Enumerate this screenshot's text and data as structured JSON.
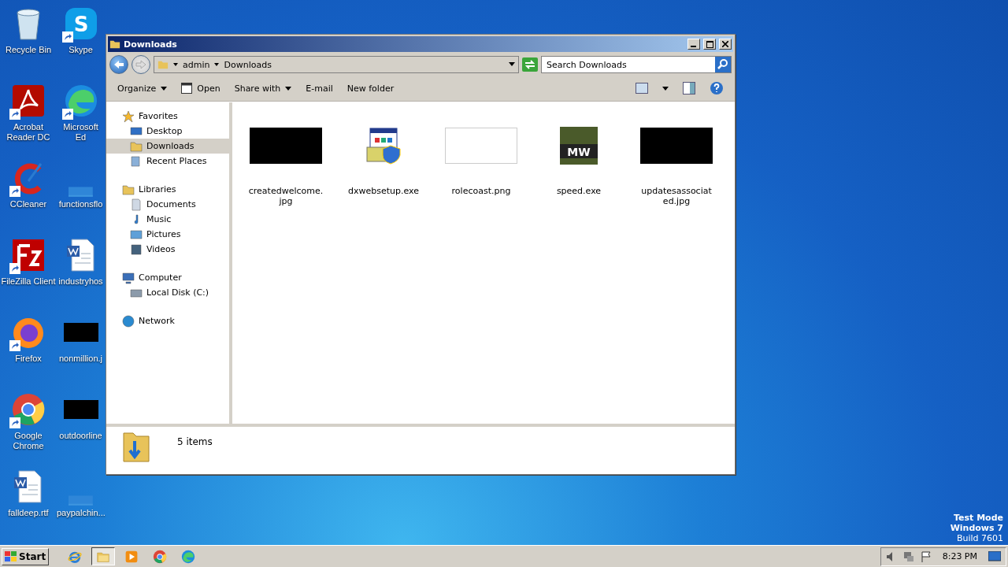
{
  "desktop_icons": [
    {
      "label": "Recycle Bin",
      "kind": "recycle",
      "shortcut": false
    },
    {
      "label": "Acrobat Reader DC",
      "kind": "acrobat",
      "shortcut": true
    },
    {
      "label": "CCleaner",
      "kind": "ccleaner",
      "shortcut": true
    },
    {
      "label": "FileZilla Client",
      "kind": "filezilla",
      "shortcut": true
    },
    {
      "label": "Firefox",
      "kind": "firefox",
      "shortcut": true
    },
    {
      "label": "Google Chrome",
      "kind": "chrome",
      "shortcut": true
    },
    {
      "label": "falldeep.rtf",
      "kind": "word",
      "shortcut": false
    },
    {
      "label": "Skype",
      "kind": "skype",
      "shortcut": true,
      "glyph": "S"
    },
    {
      "label": "Microsoft Ed",
      "kind": "edge",
      "shortcut": true
    },
    {
      "label": "functionsflo",
      "kind": "blank",
      "shortcut": false
    },
    {
      "label": "industryhos",
      "kind": "word",
      "shortcut": false
    },
    {
      "label": "nonmillion.j",
      "kind": "image",
      "shortcut": false
    },
    {
      "label": "outdoorline",
      "kind": "image",
      "shortcut": false
    },
    {
      "label": "paypalchin...",
      "kind": "blank",
      "shortcut": false
    }
  ],
  "window": {
    "title": "Downloads",
    "breadcrumb": [
      "admin",
      "Downloads"
    ],
    "search": {
      "placeholder": "Search Downloads"
    },
    "toolbar": [
      {
        "label": "Organize",
        "dropdown": true,
        "kind": "text"
      },
      {
        "label": "Open",
        "dropdown": false,
        "kind": "open"
      },
      {
        "label": "Share with",
        "dropdown": true,
        "kind": "text"
      },
      {
        "label": "E-mail",
        "dropdown": false,
        "kind": "text"
      },
      {
        "label": "New folder",
        "dropdown": false,
        "kind": "text"
      }
    ],
    "nav": [
      {
        "label": "Favorites",
        "kind": "star",
        "selected": false,
        "children": [
          {
            "label": "Desktop",
            "kind": "desktop",
            "selected": false
          },
          {
            "label": "Downloads",
            "kind": "downloads",
            "selected": true
          },
          {
            "label": "Recent Places",
            "kind": "recent",
            "selected": false
          }
        ]
      },
      {
        "label": "Libraries",
        "kind": "library",
        "selected": false,
        "children": [
          {
            "label": "Documents",
            "kind": "documents",
            "selected": false
          },
          {
            "label": "Music",
            "kind": "music",
            "selected": false
          },
          {
            "label": "Pictures",
            "kind": "pictures",
            "selected": false
          },
          {
            "label": "Videos",
            "kind": "videos",
            "selected": false
          }
        ]
      },
      {
        "label": "Computer",
        "kind": "computer",
        "selected": false,
        "children": [
          {
            "label": "Local Disk (C:)",
            "kind": "disk",
            "selected": false
          }
        ]
      },
      {
        "label": "Network",
        "kind": "network",
        "selected": false
      }
    ],
    "files": [
      {
        "name": "createdwelcome.jpg",
        "kind": "dark-image"
      },
      {
        "name": "dxwebsetup.exe",
        "kind": "installer"
      },
      {
        "name": "rolecoast.png",
        "kind": "light-image"
      },
      {
        "name": "speed.exe",
        "kind": "game",
        "glyph": "MW"
      },
      {
        "name": "updatesassociated.jpg",
        "kind": "dark-image"
      }
    ],
    "status": "5 items"
  },
  "os_notice": [
    "Test Mode",
    "Windows 7",
    "Build 7601"
  ],
  "taskbar": {
    "start": "Start",
    "apps": [
      {
        "kind": "ie",
        "selected": false
      },
      {
        "kind": "explorer",
        "selected": true
      },
      {
        "kind": "media",
        "selected": false
      },
      {
        "kind": "chrome",
        "selected": false
      },
      {
        "kind": "edge",
        "selected": false
      }
    ],
    "time": "8:23 PM"
  }
}
